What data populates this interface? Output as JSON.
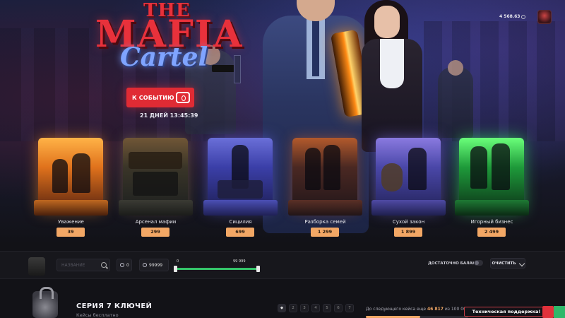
{
  "hero": {
    "logo_line1": "THE",
    "logo_line2": "MAFIA",
    "logo_line3": "Cartel",
    "event_button": "К СОБЫТИЮ",
    "timer": "21 ДНЕЙ 13:45:39"
  },
  "header": {
    "balance": "4 568.63",
    "avatar": "user-avatar"
  },
  "cases": [
    {
      "name": "Уважение",
      "price": "39"
    },
    {
      "name": "Арсенал мафии",
      "price": "299"
    },
    {
      "name": "Сицилия",
      "price": "699"
    },
    {
      "name": "Разборка семей",
      "price": "1 299"
    },
    {
      "name": "Сухой закон",
      "price": "1 899"
    },
    {
      "name": "Игорный бизнес",
      "price": "2 499"
    }
  ],
  "filter": {
    "search_placeholder": "НАЗВАНИЕ",
    "min_value": "0",
    "max_value": "99999",
    "range_min_label": "0",
    "range_max_label": "99 999",
    "balance_label": "ДОСТАТОЧНО БАЛАНСА",
    "clear_button": "ОЧИСТИТЬ"
  },
  "series": {
    "title": "СЕРИЯ 7 КЛЮЧЕЙ",
    "subtitle": "Кейсы бесплатно",
    "days": [
      "",
      "2",
      "3",
      "4",
      "5",
      "6",
      "7"
    ],
    "next_case_prefix": "До следующего кейса еще",
    "next_case_remaining": "46 817",
    "next_case_of": "из 100 000",
    "progress_fraction": 0.53
  },
  "support": {
    "label": "Техническая поддержка!"
  },
  "colors": {
    "accent_red": "#e02b34",
    "price_orange": "#f2a765",
    "range_green": "#35c46a"
  }
}
